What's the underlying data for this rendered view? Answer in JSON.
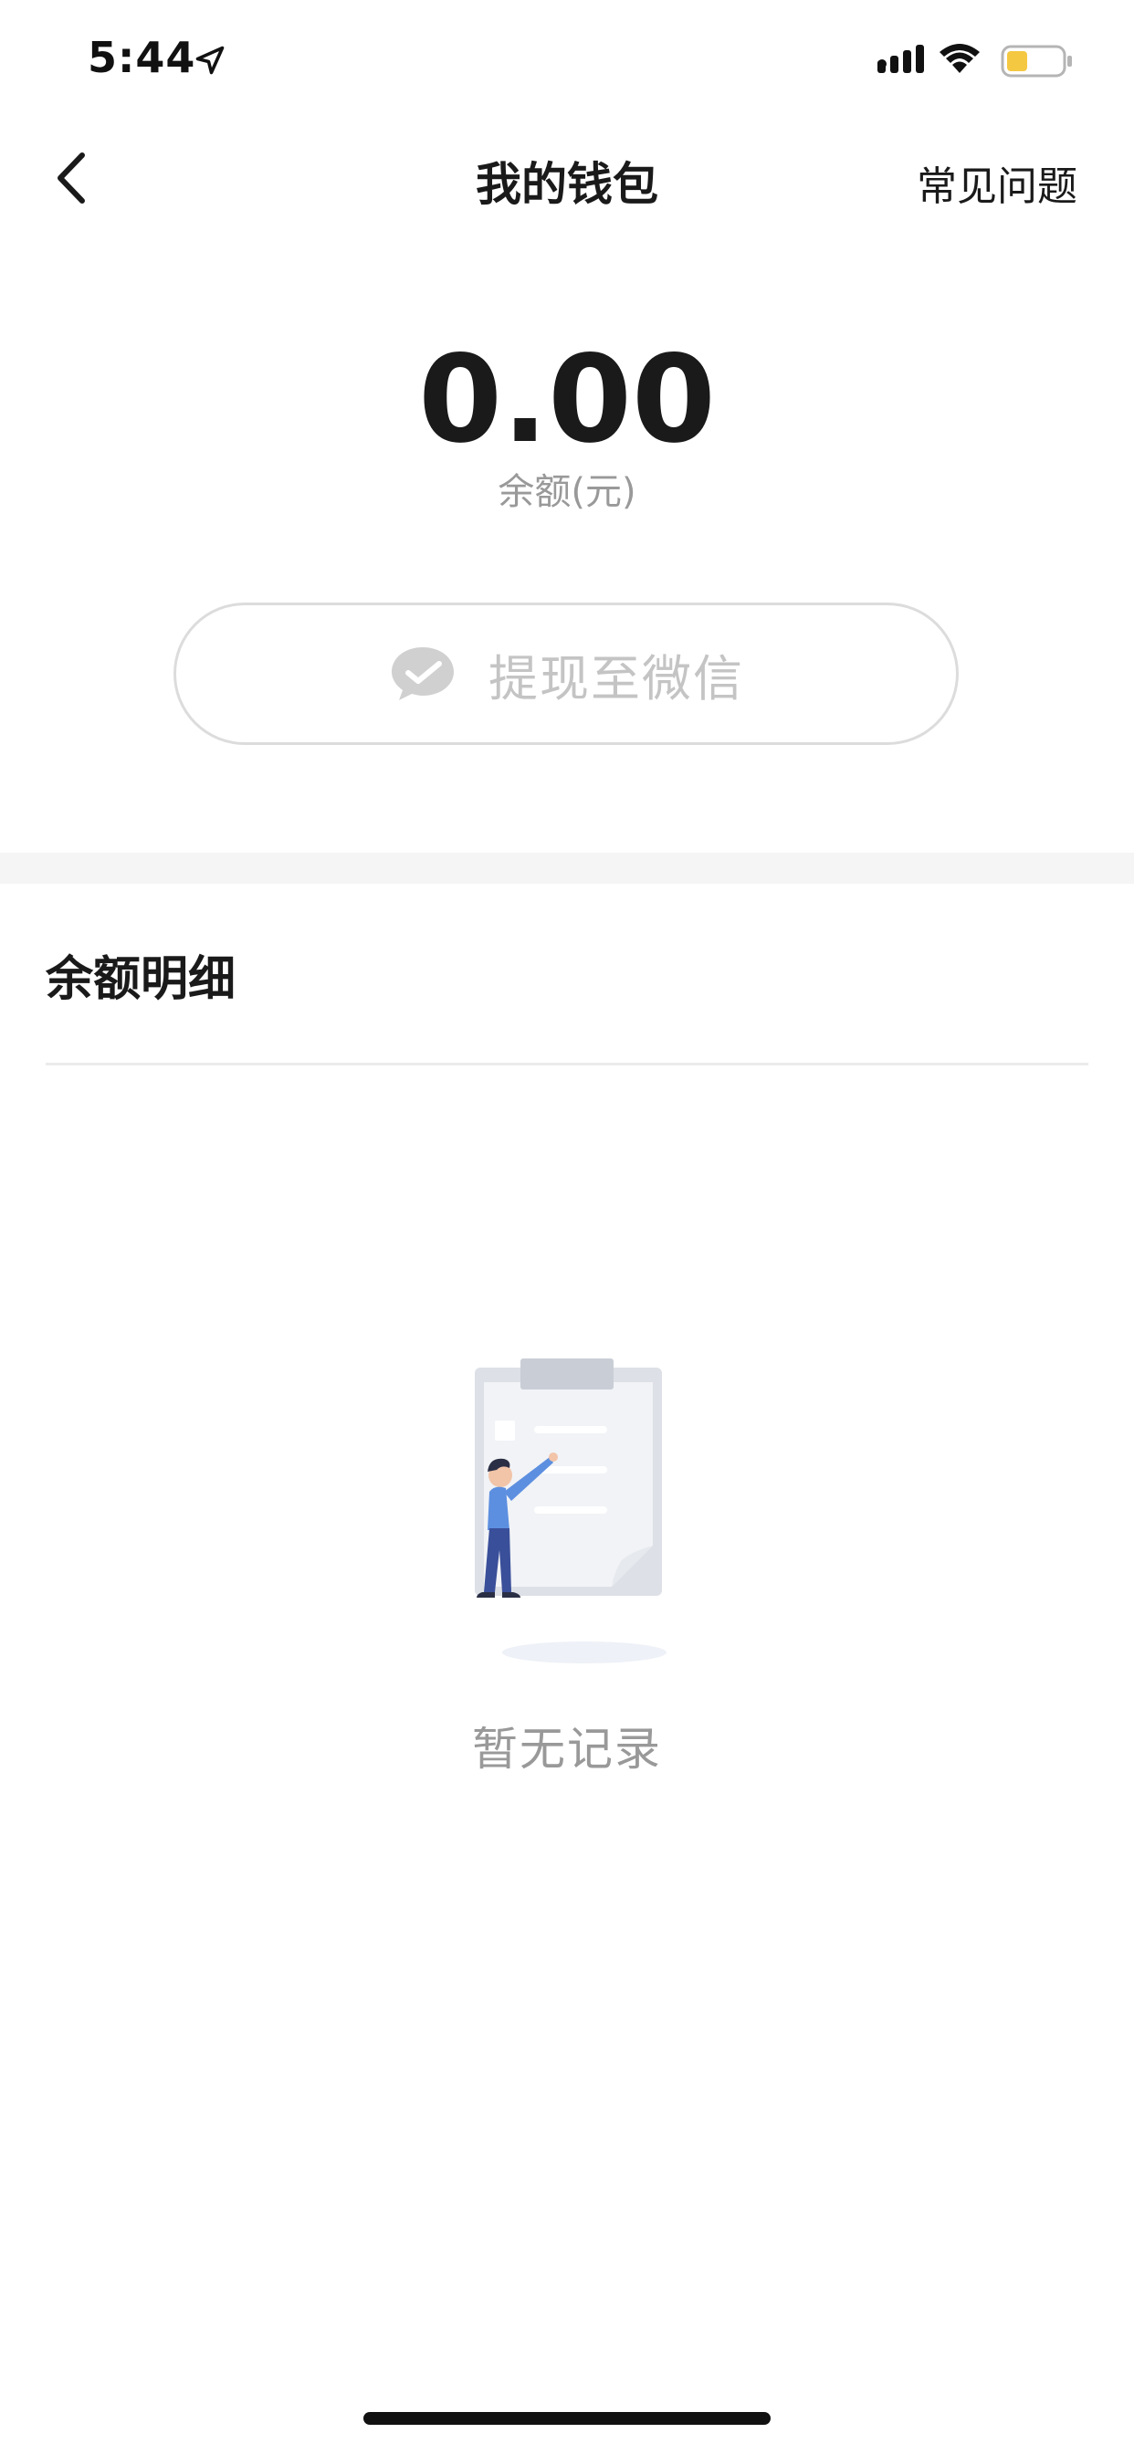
{
  "status_bar": {
    "time": "5:44",
    "battery_color": "#f5c842"
  },
  "nav": {
    "title": "我的钱包",
    "faq_label": "常见问题"
  },
  "balance": {
    "amount": "0.00",
    "label": "余额(元)"
  },
  "withdraw": {
    "label": "提现至微信",
    "icon": "wechat-icon"
  },
  "details": {
    "title": "余额明细",
    "empty_text": "暂无记录"
  },
  "colors": {
    "accent_text": "#1a1a1a",
    "muted_text": "#999999",
    "disabled_text": "#c4c4c4"
  }
}
